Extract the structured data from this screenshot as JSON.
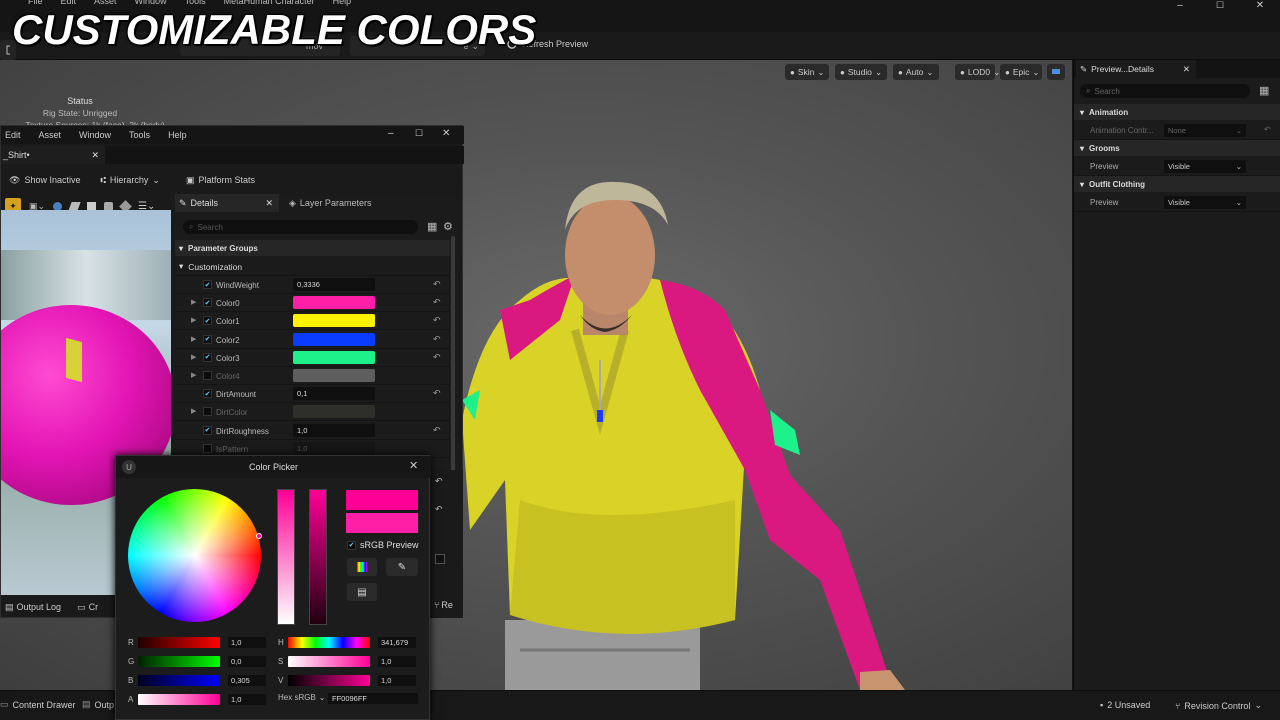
{
  "overlay_title": "CUSTOMIZABLE COLORS",
  "main_menu": [
    "File",
    "Edit",
    "Asset",
    "Window",
    "Tools",
    "MetaHuman Character",
    "Help"
  ],
  "toolbar": {
    "partial_label": "e",
    "refresh_label": "Refresh Preview",
    "hidden_label": "mov"
  },
  "status_overlay": {
    "title": "Status",
    "rig_state": "Rig State: Unrigged",
    "texture_sources": "Texture Sources: 1k (face), 2k (body)"
  },
  "viewport_buttons": [
    {
      "icon": "skin-icon",
      "label": "Skin"
    },
    {
      "icon": "light-bulb-icon",
      "label": "Studio"
    },
    {
      "icon": "camera-icon",
      "label": "Auto"
    },
    {
      "icon": "lod-icon",
      "label": "LOD0"
    },
    {
      "icon": "quality-icon",
      "label": "Epic"
    }
  ],
  "right_panel": {
    "tab_label": "Preview...Details",
    "search_placeholder": "Search",
    "sections": [
      {
        "title": "Animation",
        "rows": [
          {
            "label": "Animation Contr...",
            "value": "None",
            "disabled": true
          }
        ]
      },
      {
        "title": "Grooms",
        "rows": [
          {
            "label": "Preview",
            "value": "Visible",
            "disabled": false
          }
        ]
      },
      {
        "title": "Outfit Clothing",
        "rows": [
          {
            "label": "Preview",
            "value": "Visible",
            "disabled": false
          }
        ]
      }
    ]
  },
  "material_editor": {
    "menu": [
      "Edit",
      "Asset",
      "Window",
      "Tools",
      "Help"
    ],
    "tab_label": "_Shirt•",
    "toolbar": {
      "show_inactive": "Show Inactive",
      "hierarchy": "Hierarchy",
      "platform_stats": "Platform Stats"
    },
    "details_tab": "Details",
    "layer_tab": "Layer Parameters",
    "search_placeholder": "Search",
    "group_header": "Parameter Groups",
    "subgroup": "Customization",
    "params": [
      {
        "name": "WindWeight",
        "checked": true,
        "expand": false,
        "kind": "value",
        "value": "0,3336"
      },
      {
        "name": "Color0",
        "checked": true,
        "expand": true,
        "kind": "color",
        "color": "#ff1fa6"
      },
      {
        "name": "Color1",
        "checked": true,
        "expand": true,
        "kind": "color",
        "color": "#fff200"
      },
      {
        "name": "Color2",
        "checked": true,
        "expand": true,
        "kind": "color",
        "color": "#0a3cff"
      },
      {
        "name": "Color3",
        "checked": true,
        "expand": true,
        "kind": "color",
        "color": "#1ef08a"
      },
      {
        "name": "Color4",
        "checked": false,
        "expand": true,
        "kind": "color",
        "color": "#5e5e5e"
      },
      {
        "name": "DirtAmount",
        "checked": true,
        "expand": false,
        "kind": "value",
        "value": "0,1"
      },
      {
        "name": "DirtColor",
        "checked": false,
        "expand": true,
        "kind": "color",
        "color": "#2e2f29"
      },
      {
        "name": "DirtRoughness",
        "checked": true,
        "expand": false,
        "kind": "value",
        "value": "1,0"
      },
      {
        "name": "IsPattern",
        "checked": false,
        "expand": false,
        "kind": "value",
        "value": "1,0"
      }
    ]
  },
  "color_picker": {
    "title": "Color Picker",
    "srgb_label": "sRGB Preview",
    "new_color": "#ff0096",
    "old_color": "#ff1fa6",
    "channels": [
      {
        "label": "R",
        "value": "1,0",
        "gradient": "linear-gradient(90deg,#200000,#ff0000)"
      },
      {
        "label": "G",
        "value": "0,0",
        "gradient": "linear-gradient(90deg,#002000,#00ff00)"
      },
      {
        "label": "B",
        "value": "0,305",
        "gradient": "linear-gradient(90deg,#000020,#0000ff)"
      },
      {
        "label": "A",
        "value": "1,0",
        "gradient": "linear-gradient(90deg,#ffffff,#ff0096)"
      }
    ],
    "hsv": [
      {
        "label": "H",
        "value": "341,679",
        "gradient": "linear-gradient(90deg,#ff0000,#ffff00,#00ff00,#00ffff,#0000ff,#ff00ff,#ff0000)"
      },
      {
        "label": "S",
        "value": "1,0",
        "gradient": "linear-gradient(90deg,#ffffff,#ff0096)"
      },
      {
        "label": "V",
        "value": "1,0",
        "gradient": "linear-gradient(90deg,#000000,#ff0096)"
      }
    ],
    "hex_label": "Hex sRGB",
    "hex_value": "FF0096FF"
  },
  "side_partial": {
    "label": "Re"
  },
  "status_bar": {
    "content_drawer": "Content Drawer",
    "output_partial": "Outp",
    "output_log": "Output Log",
    "cmd_partial": "Cr",
    "unsaved": "2 Unsaved",
    "revision": "Revision Control"
  }
}
